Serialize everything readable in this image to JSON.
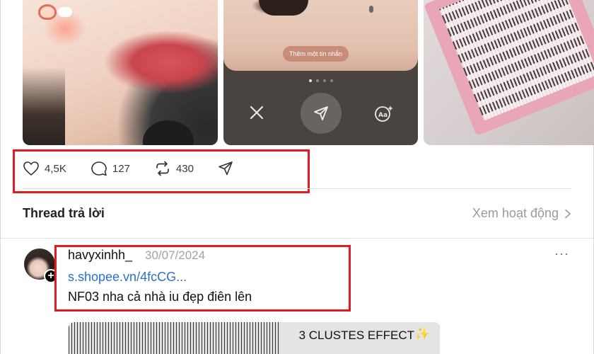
{
  "carousel": {
    "photo2_message_placeholder": "Thêm một tin nhắn"
  },
  "actions": {
    "likes": "4,5K",
    "comments": "127",
    "reposts": "430"
  },
  "thread": {
    "title": "Thread trả lời",
    "activity_link": "Xem hoạt động"
  },
  "reply": {
    "username": "havyxinhh_",
    "date": "30/07/2024",
    "more": "···",
    "link": "s.shopee.vn/4fcCG...",
    "text": "NF03 nha cả nhà iu đẹp điên lên",
    "avatar_badge": "+",
    "promo_text": "3 CLUSTES EFFECT",
    "promo_star": "✨"
  },
  "colors": {
    "highlight": "#e01b24",
    "link": "#2b72c7",
    "muted": "#9a9a9a"
  },
  "icons": [
    "heart-icon",
    "comment-icon",
    "repost-icon",
    "share-icon",
    "chevron-right-icon",
    "close-icon",
    "send-icon",
    "text-style-icon"
  ]
}
